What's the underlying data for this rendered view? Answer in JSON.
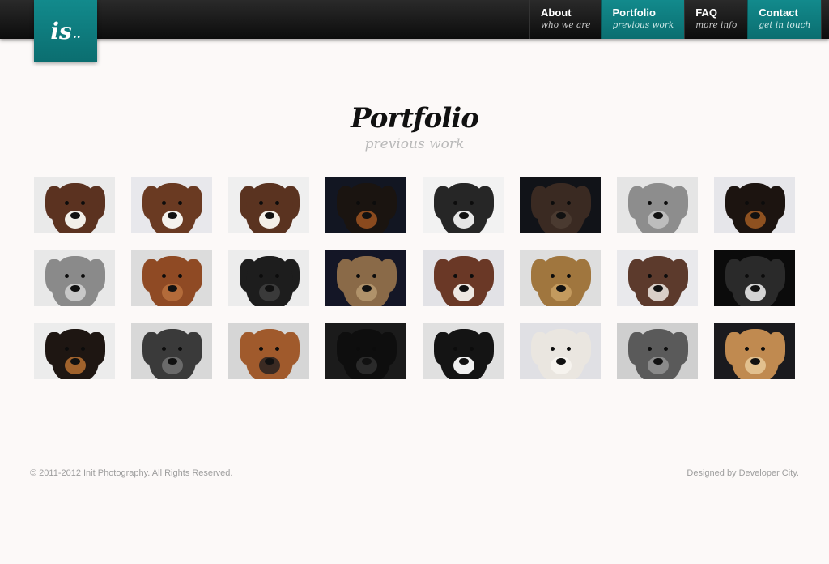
{
  "brand": {
    "logo_text": "is",
    "logo_dots": ".."
  },
  "nav": [
    {
      "title": "About",
      "sub": "who we are",
      "teal": false
    },
    {
      "title": "Portfolio",
      "sub": "previous work",
      "teal": true
    },
    {
      "title": "FAQ",
      "sub": "more info",
      "teal": false
    },
    {
      "title": "Contact",
      "sub": "get in touch",
      "teal": true
    }
  ],
  "page": {
    "title": "Portfolio",
    "subtitle": "previous work"
  },
  "thumbnails": [
    {
      "icon": "brown-white-spaniel-photo",
      "bg": "#eaeaea",
      "fur": "#5b3220",
      "face": "#f2efe9"
    },
    {
      "icon": "springer-spaniel-photo",
      "bg": "#e8e8ec",
      "fur": "#6a3a22",
      "face": "#f4f1ec"
    },
    {
      "icon": "spaniel-closeup-photo",
      "bg": "#efefef",
      "fur": "#5a3320",
      "face": "#f3efe8"
    },
    {
      "icon": "doberman-photo",
      "bg": "#121622",
      "fur": "#1a1410",
      "face": "#8a4a1e"
    },
    {
      "icon": "bw-spaniel-photo",
      "bg": "#f2f2f2",
      "fur": "#262626",
      "face": "#e6e6e6"
    },
    {
      "icon": "dark-spaniel-photo",
      "bg": "#111318",
      "fur": "#3a2a22",
      "face": "#4a3a30"
    },
    {
      "icon": "bw-mastiff-photo",
      "bg": "#e5e5e5",
      "fur": "#8d8d8d",
      "face": "#bdbdbd"
    },
    {
      "icon": "doberman-portrait-photo",
      "bg": "#e6e6ea",
      "fur": "#1c1410",
      "face": "#8e5120"
    },
    {
      "icon": "bw-terrier-photo",
      "bg": "#e8e8e8",
      "fur": "#8a8a8a",
      "face": "#c8c8c8"
    },
    {
      "icon": "bordeaux-mastiff-photo",
      "bg": "#dcdcdc",
      "fur": "#8f4a24",
      "face": "#b36b3a"
    },
    {
      "icon": "bw-doberman-photo",
      "bg": "#ececec",
      "fur": "#1d1d1d",
      "face": "#3a3a3a"
    },
    {
      "icon": "border-terrier-photo",
      "bg": "#141626",
      "fur": "#8a6a48",
      "face": "#b0926a"
    },
    {
      "icon": "spotted-spaniel-photo",
      "bg": "#e2e2e6",
      "fur": "#6a3826",
      "face": "#eee8e2"
    },
    {
      "icon": "golden-terrier-photo",
      "bg": "#dedede",
      "fur": "#a0763e",
      "face": "#c39a5e"
    },
    {
      "icon": "lying-spaniel-photo",
      "bg": "#e9e9ec",
      "fur": "#5c3a2c",
      "face": "#d9cfc8"
    },
    {
      "icon": "bw-cocker-photo",
      "bg": "#0b0b0b",
      "fur": "#2a2a2a",
      "face": "#d4d4d4"
    },
    {
      "icon": "two-dogs-photo",
      "bg": "#ececec",
      "fur": "#1e1612",
      "face": "#a0622c"
    },
    {
      "icon": "bw-curly-spaniel-photo",
      "bg": "#d8d8d8",
      "fur": "#3a3a3a",
      "face": "#6a6a6a"
    },
    {
      "icon": "boxer-photo",
      "bg": "#d6d6d6",
      "fur": "#a05a2c",
      "face": "#3a2a22"
    },
    {
      "icon": "black-spaniel-photo",
      "bg": "#1b1b1b",
      "fur": "#0e0e0e",
      "face": "#2a2a2a"
    },
    {
      "icon": "border-collie-photo",
      "bg": "#e0e0e0",
      "fur": "#141414",
      "face": "#f0f0f0"
    },
    {
      "icon": "westie-photo",
      "bg": "#e0e0e4",
      "fur": "#eae6e0",
      "face": "#f6f3ee"
    },
    {
      "icon": "bw-bulldog-photo",
      "bg": "#cfcfcf",
      "fur": "#5a5a5a",
      "face": "#8a8a8a"
    },
    {
      "icon": "golden-retriever-photo",
      "bg": "#1a1a1e",
      "fur": "#c08a50",
      "face": "#e2c08e"
    }
  ],
  "footer": {
    "copyright": "© 2011-2012 Init Photography. All Rights Reserved.",
    "credit": "Designed by Developer City."
  }
}
